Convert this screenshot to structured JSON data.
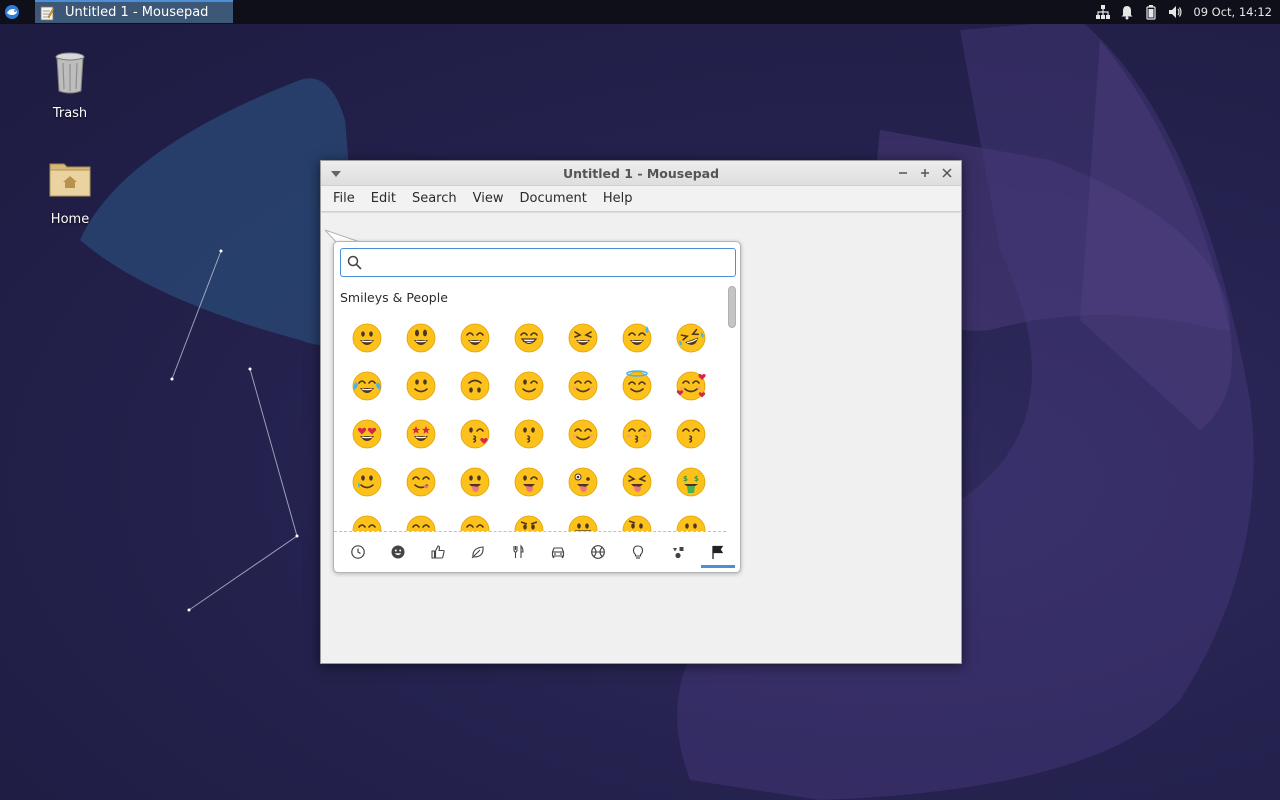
{
  "panel": {
    "task_title": "Untitled 1 - Mousepad",
    "clock": "09 Oct, 14:12",
    "tray_icons": [
      "network-icon",
      "notification-bell-icon",
      "battery-icon",
      "volume-icon"
    ]
  },
  "desktop": {
    "icons": [
      {
        "label": "Trash",
        "icon": "trash-icon"
      },
      {
        "label": "Home",
        "icon": "home-folder-icon"
      }
    ]
  },
  "window": {
    "title": "Untitled 1 - Mousepad",
    "menu": [
      "File",
      "Edit",
      "Search",
      "View",
      "Document",
      "Help"
    ],
    "editor_text": ""
  },
  "emoji_chooser": {
    "search_value": "",
    "section_title": "Smileys & People",
    "emojis": [
      "grinning-face",
      "grinning-face-big-eyes",
      "grinning-face-smiling-eyes",
      "beaming-face",
      "grinning-squinting-face",
      "grinning-face-sweat",
      "rolling-on-floor-laughing",
      "face-with-tears-of-joy",
      "slightly-smiling-face",
      "upside-down-face",
      "winking-face",
      "smiling-face-smiling-eyes",
      "smiling-face-halo",
      "smiling-face-hearts",
      "heart-eyes",
      "star-struck",
      "face-blowing-kiss",
      "kissing-face",
      "smiling-face",
      "kissing-face-closed-eyes",
      "kissing-face-smiling-eyes",
      "smiling-face-tear",
      "face-savoring-food",
      "face-with-tongue",
      "winking-face-tongue",
      "zany-face",
      "squinting-face-tongue",
      "money-mouth-face",
      "face-partial-1",
      "face-partial-2",
      "face-partial-3",
      "face-partial-4",
      "face-partial-5",
      "face-partial-6",
      "face-partial-7"
    ],
    "categories": [
      {
        "name": "recent",
        "icon": "clock-icon"
      },
      {
        "name": "smileys",
        "icon": "smiley-icon"
      },
      {
        "name": "body",
        "icon": "thumbs-up-icon"
      },
      {
        "name": "nature",
        "icon": "leaf-icon"
      },
      {
        "name": "food",
        "icon": "cutlery-icon"
      },
      {
        "name": "travel",
        "icon": "car-icon"
      },
      {
        "name": "activities",
        "icon": "ball-icon"
      },
      {
        "name": "objects",
        "icon": "bulb-icon"
      },
      {
        "name": "symbols",
        "icon": "symbols-icon"
      },
      {
        "name": "flags",
        "icon": "flag-icon"
      }
    ],
    "active_category": "flags",
    "accent": "#4a90d9"
  }
}
